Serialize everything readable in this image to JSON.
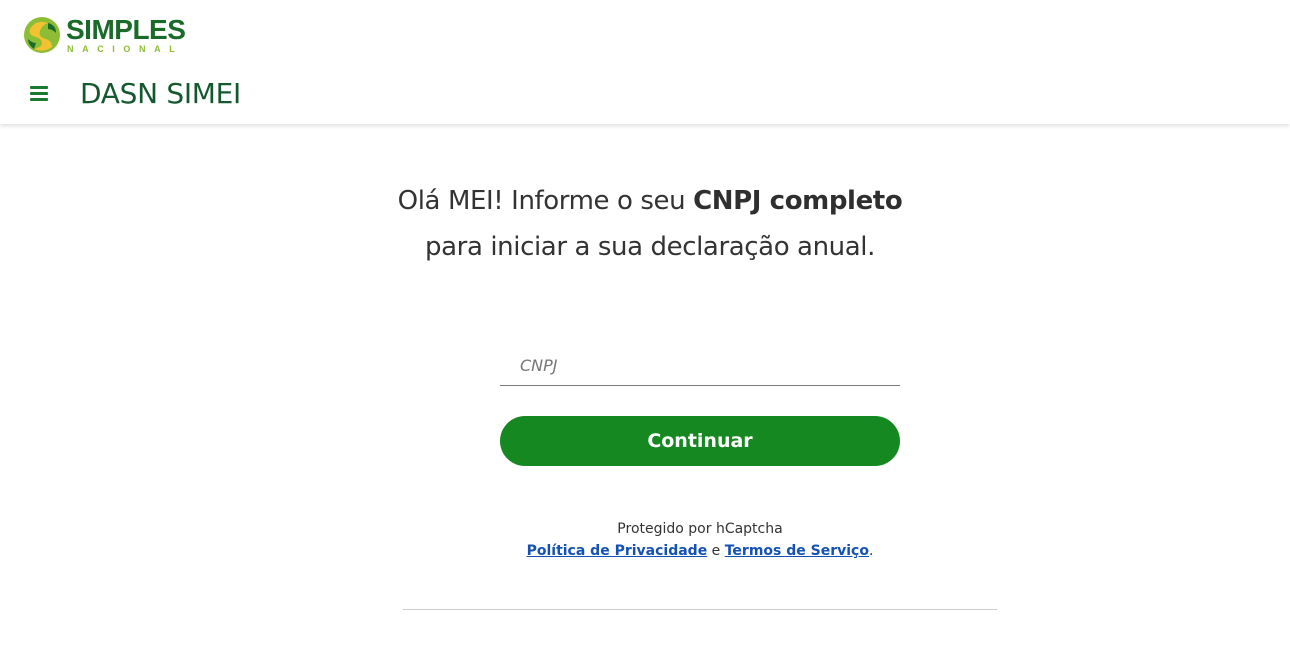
{
  "header": {
    "logo": {
      "word": "SIMPLES",
      "sub": "NACIONAL"
    },
    "menu_icon": "hamburger-menu-icon",
    "title": "DASN SIMEI"
  },
  "main": {
    "headline_part1": "Olá MEI! Informe o seu ",
    "headline_bold": "CNPJ completo",
    "headline_part2": "para iniciar a sua declaração anual.",
    "cnpj_input": {
      "placeholder": "CNPJ",
      "value": ""
    },
    "continue_label": "Continuar"
  },
  "captcha": {
    "protected_text": "Protegido por hCaptcha",
    "privacy_link": "Política de Privacidade",
    "conjunction": "e",
    "terms_link": "Termos de Serviço",
    "end": "."
  },
  "colors": {
    "brand_green": "#168821",
    "title_green": "#15582d",
    "link_blue": "#1351b4",
    "logo_light_green": "#8cbd34",
    "logo_yellow": "#f2c230"
  }
}
